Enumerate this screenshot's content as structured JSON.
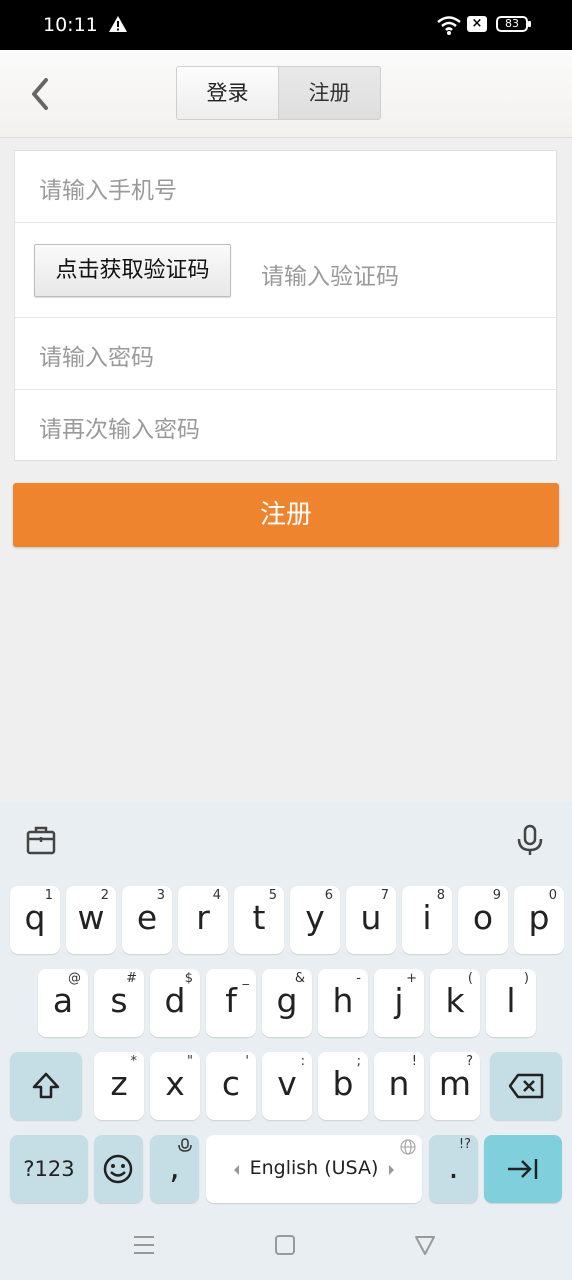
{
  "status_bar": {
    "time": "10:11",
    "battery": "83"
  },
  "header": {
    "tabs": {
      "login": "登录",
      "register": "注册"
    }
  },
  "form": {
    "phone_placeholder": "请输入手机号",
    "get_code_button": "点击获取验证码",
    "code_placeholder": "请输入验证码",
    "password_placeholder": "请输入密码",
    "confirm_password_placeholder": "请再次输入密码"
  },
  "submit_label": "注册",
  "keyboard": {
    "row1": [
      {
        "ch": "q",
        "hint": "1"
      },
      {
        "ch": "w",
        "hint": "2"
      },
      {
        "ch": "e",
        "hint": "3"
      },
      {
        "ch": "r",
        "hint": "4"
      },
      {
        "ch": "t",
        "hint": "5"
      },
      {
        "ch": "y",
        "hint": "6"
      },
      {
        "ch": "u",
        "hint": "7"
      },
      {
        "ch": "i",
        "hint": "8"
      },
      {
        "ch": "o",
        "hint": "9"
      },
      {
        "ch": "p",
        "hint": "0"
      }
    ],
    "row2": [
      {
        "ch": "a",
        "hint": "@"
      },
      {
        "ch": "s",
        "hint": "#"
      },
      {
        "ch": "d",
        "hint": "$"
      },
      {
        "ch": "f",
        "hint": "_"
      },
      {
        "ch": "g",
        "hint": "&"
      },
      {
        "ch": "h",
        "hint": "-"
      },
      {
        "ch": "j",
        "hint": "+"
      },
      {
        "ch": "k",
        "hint": "("
      },
      {
        "ch": "l",
        "hint": ")"
      }
    ],
    "row3": [
      {
        "ch": "z",
        "hint": "*"
      },
      {
        "ch": "x",
        "hint": "\""
      },
      {
        "ch": "c",
        "hint": "'"
      },
      {
        "ch": "v",
        "hint": ":"
      },
      {
        "ch": "b",
        "hint": ";"
      },
      {
        "ch": "n",
        "hint": "!"
      },
      {
        "ch": "m",
        "hint": "?"
      }
    ],
    "symbols_label": "?123",
    "comma": ",",
    "space_label": "English (USA)",
    "period": ".",
    "period_hint": "!?"
  }
}
